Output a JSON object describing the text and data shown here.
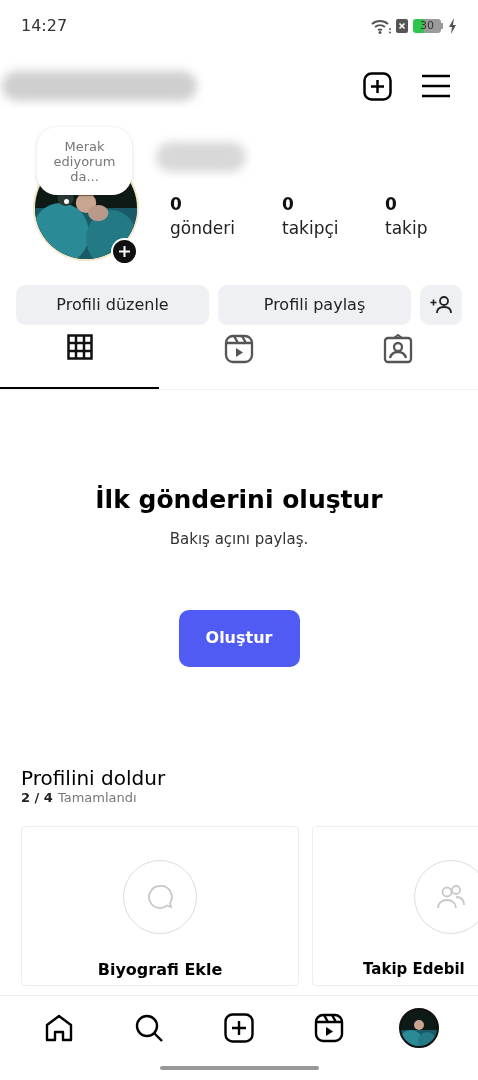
{
  "status_bar": {
    "time": "14:27",
    "battery": "30",
    "charging": true
  },
  "profile": {
    "bubble_note": "Merak ediyorum da...",
    "stats": [
      {
        "value": "0",
        "label": "gönderi"
      },
      {
        "value": "0",
        "label": "takipçi"
      },
      {
        "value": "0",
        "label": "takip"
      }
    ],
    "buttons": [
      "Profili düzenle",
      "Profili paylaş"
    ]
  },
  "tabs": [
    {
      "kind": "grid",
      "selected": true
    },
    {
      "kind": "reels",
      "selected": false
    },
    {
      "kind": "tagged",
      "selected": false
    }
  ],
  "empty_state": {
    "title": "İlk gönderini oluştur",
    "subtitle": "Bakış açını paylaş.",
    "button": "Oluştur"
  },
  "complete_profile": {
    "title": "Profilini doldur",
    "progress_count": "2 / 4",
    "progress_label": "Tamamlandı",
    "cards": [
      {
        "kind": "bio",
        "title": "Biyografi Ekle"
      },
      {
        "kind": "follow",
        "title": "Takip Edebil"
      }
    ]
  },
  "bottom_nav": [
    {
      "kind": "home"
    },
    {
      "kind": "search"
    },
    {
      "kind": "create"
    },
    {
      "kind": "reels"
    },
    {
      "kind": "profile"
    }
  ]
}
